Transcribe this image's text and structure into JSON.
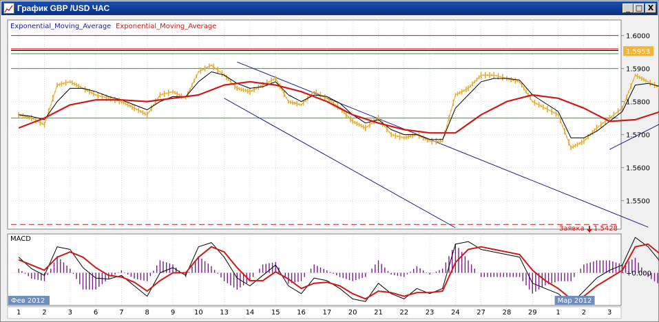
{
  "window": {
    "title": "График GBP /USD ЧАС",
    "buttons": {
      "minimize": "_",
      "maximize": "□",
      "close": "X"
    }
  },
  "chart_data": [
    {
      "type": "line",
      "panel": "price",
      "legend": [
        "Exponential_Moving_Average",
        "Exponential_Moving_Average"
      ],
      "y_ticks": [
        "1.6000",
        "1.5900",
        "1.5800",
        "1.5700",
        "1.5600",
        "1.5500"
      ],
      "ylim": [
        1.5418,
        1.6043
      ],
      "current_price": "1.5953",
      "order_label": "Заявка",
      "order_price": "1.5428",
      "x_tick_labels": [
        "1",
        "2",
        "3",
        "6",
        "7",
        "8",
        "9",
        "10",
        "13",
        "14",
        "15",
        "16",
        "17",
        "20",
        "21",
        "22",
        "23",
        "24",
        "27",
        "28",
        "29",
        "1",
        "2",
        "3"
      ],
      "period_labels": [
        "Фев 2012",
        "Мар 2012"
      ],
      "colors": {
        "price": "#e6a92b",
        "ema_fast": "#000000",
        "ema_slow": "#d01818",
        "horizontal_red": "#c81818",
        "horizontal_green": "#22aa22",
        "channel": "#1c1c8c"
      },
      "horizontal_lines": [
        {
          "price": 1.6,
          "color": "red"
        },
        {
          "price": 1.596,
          "color": "red"
        },
        {
          "price": 1.5955,
          "color": "dark"
        },
        {
          "price": 1.5945,
          "color": "green"
        },
        {
          "price": 1.59,
          "color": "green"
        },
        {
          "price": 1.575,
          "color": "green"
        },
        {
          "price": 1.5428,
          "color": "red-dashed"
        }
      ],
      "trendlines": [
        {
          "from": {
            "x": 8.5,
            "y": 1.592
          },
          "to": {
            "x": 24.5,
            "y": 1.542
          }
        },
        {
          "from": {
            "x": 8.0,
            "y": 1.581
          },
          "to": {
            "x": 17.0,
            "y": 1.5418
          }
        },
        {
          "from": {
            "x": 23.0,
            "y": 1.5655
          },
          "to": {
            "x": 32.5,
            "y": 1.603
          }
        }
      ],
      "series": [
        {
          "name": "close",
          "x": [
            0,
            0.5,
            1,
            1.5,
            2,
            2.5,
            3,
            3.5,
            4,
            4.5,
            5,
            5.5,
            6,
            6.5,
            7,
            7.5,
            8,
            8.5,
            9,
            9.5,
            10,
            10.5,
            11,
            11.5,
            12,
            12.5,
            13,
            13.5,
            14,
            14.5,
            15,
            15.5,
            16,
            16.5,
            17,
            17.5,
            18,
            18.5,
            19,
            19.5,
            20,
            20.5,
            21,
            21.5,
            22,
            22.5,
            23,
            23.5,
            24,
            24.5,
            25,
            25.5,
            26,
            26.5,
            27,
            27.5,
            28,
            28.5,
            29,
            29.5,
            30,
            30.5,
            31
          ],
          "values": [
            1.576,
            1.575,
            1.573,
            1.585,
            1.586,
            1.584,
            1.582,
            1.581,
            1.58,
            1.578,
            1.576,
            1.582,
            1.583,
            1.581,
            1.589,
            1.591,
            1.588,
            1.584,
            1.583,
            1.585,
            1.587,
            1.58,
            1.579,
            1.583,
            1.581,
            1.578,
            1.574,
            1.572,
            1.575,
            1.57,
            1.569,
            1.57,
            1.568,
            1.568,
            1.582,
            1.584,
            1.588,
            1.588,
            1.587,
            1.586,
            1.58,
            1.578,
            1.576,
            1.566,
            1.568,
            1.572,
            1.575,
            1.578,
            1.588,
            1.586,
            1.584,
            1.583,
            1.585,
            1.586,
            1.589,
            1.593,
            1.592,
            1.591,
            1.593,
            1.594,
            1.595,
            1.5953,
            1.5953
          ]
        },
        {
          "name": "ema_fast",
          "x": [
            0,
            0.5,
            1,
            1.5,
            2,
            2.5,
            3,
            3.5,
            4,
            4.5,
            5,
            5.5,
            6,
            6.5,
            7,
            7.5,
            8,
            8.5,
            9,
            9.5,
            10,
            10.5,
            11,
            11.5,
            12,
            12.5,
            13,
            13.5,
            14,
            14.5,
            15,
            15.5,
            16,
            16.5,
            17,
            17.5,
            18,
            18.5,
            19,
            19.5,
            20,
            20.5,
            21,
            21.5,
            22,
            22.5,
            23,
            23.5,
            24,
            24.5,
            25,
            25.5,
            26,
            26.5,
            27,
            27.5,
            28,
            28.5,
            29,
            29.5,
            30,
            30.5
          ],
          "values": [
            1.576,
            1.5755,
            1.5745,
            1.58,
            1.584,
            1.584,
            1.583,
            1.5815,
            1.5805,
            1.579,
            1.5775,
            1.58,
            1.5815,
            1.5815,
            1.586,
            1.589,
            1.588,
            1.5855,
            1.584,
            1.5845,
            1.586,
            1.582,
            1.58,
            1.582,
            1.5815,
            1.5795,
            1.576,
            1.5735,
            1.5745,
            1.5715,
            1.57,
            1.57,
            1.5685,
            1.5685,
            1.578,
            1.582,
            1.586,
            1.587,
            1.587,
            1.5865,
            1.582,
            1.5795,
            1.577,
            1.569,
            1.569,
            1.571,
            1.574,
            1.577,
            1.585,
            1.5855,
            1.5845,
            1.5835,
            1.5845,
            1.5855,
            1.588,
            1.5915,
            1.5918,
            1.5913,
            1.5925,
            1.5935,
            1.5945,
            1.595
          ]
        },
        {
          "name": "ema_slow",
          "x": [
            0,
            1,
            2,
            3,
            4,
            5,
            6,
            7,
            8,
            9,
            10,
            11,
            12,
            13,
            14,
            15,
            16,
            17,
            18,
            19,
            20,
            21,
            22,
            23,
            24,
            25,
            26,
            27,
            28,
            29,
            30,
            30.5
          ],
          "values": [
            1.572,
            1.575,
            1.579,
            1.5805,
            1.5805,
            1.58,
            1.581,
            1.582,
            1.585,
            1.586,
            1.585,
            1.583,
            1.58,
            1.576,
            1.5735,
            1.5715,
            1.5705,
            1.5705,
            1.576,
            1.58,
            1.582,
            1.581,
            1.578,
            1.574,
            1.5745,
            1.577,
            1.581,
            1.583,
            1.586,
            1.589,
            1.5912,
            1.5922
          ]
        }
      ]
    },
    {
      "type": "line",
      "panel": "macd",
      "title": "MACD",
      "y_ticks": [
        "+0.000"
      ],
      "ylim": [
        -0.006,
        0.0072
      ],
      "series": [
        {
          "name": "macd",
          "x": [
            0,
            0.5,
            1,
            1.5,
            2,
            2.5,
            3,
            3.5,
            4,
            4.5,
            5,
            5.5,
            6,
            6.5,
            7,
            7.5,
            8,
            8.5,
            9,
            9.5,
            10,
            10.5,
            11,
            11.5,
            12,
            12.5,
            13,
            13.5,
            14,
            14.5,
            15,
            15.5,
            16,
            16.5,
            17,
            17.5,
            18,
            18.5,
            19,
            19.5,
            20,
            20.5,
            21,
            21.5,
            22,
            22.5,
            23,
            23.5,
            24,
            24.5,
            25,
            25.5,
            26,
            26.5,
            27,
            27.5,
            28,
            28.5,
            29,
            29.5,
            30,
            30.5
          ],
          "values": [
            0.003,
            0.0008,
            -0.0005,
            0.005,
            0.0045,
            0.001,
            -0.001,
            -0.0012,
            -0.0005,
            -0.0025,
            -0.0045,
            0.0,
            0.001,
            -0.0005,
            0.005,
            0.0058,
            0.003,
            -0.001,
            -0.0025,
            -0.0005,
            0.0015,
            -0.0025,
            -0.004,
            -0.001,
            -0.0015,
            -0.003,
            -0.005,
            -0.0055,
            -0.002,
            -0.004,
            -0.005,
            -0.003,
            -0.004,
            -0.003,
            0.0055,
            0.006,
            0.0045,
            0.004,
            0.0035,
            0.003,
            -0.002,
            -0.003,
            -0.004,
            -0.006,
            -0.0035,
            -0.001,
            0.0005,
            0.0015,
            0.0068,
            0.005,
            0.002,
            -0.0005,
            0.0005,
            0.0015,
            0.0035,
            0.004,
            0.0012,
            0.0005,
            0.0018,
            0.0015,
            0.0012,
            0.0015
          ]
        },
        {
          "name": "signal",
          "x": [
            0,
            0.5,
            1,
            1.5,
            2,
            2.5,
            3,
            3.5,
            4,
            4.5,
            5,
            5.5,
            6,
            6.5,
            7,
            7.5,
            8,
            8.5,
            9,
            9.5,
            10,
            10.5,
            11,
            11.5,
            12,
            12.5,
            13,
            13.5,
            14,
            14.5,
            15,
            15.5,
            16,
            16.5,
            17,
            17.5,
            18,
            18.5,
            19,
            19.5,
            20,
            20.5,
            21,
            21.5,
            22,
            22.5,
            23,
            23.5,
            24,
            24.5,
            25,
            25.5,
            26,
            26.5,
            27,
            27.5,
            28,
            28.5,
            29,
            29.5,
            30,
            30.5
          ],
          "values": [
            0.0025,
            0.0015,
            0.0005,
            0.003,
            0.004,
            0.003,
            0.001,
            -0.0005,
            -0.0008,
            -0.0018,
            -0.0035,
            -0.0015,
            0.0,
            0.0,
            0.003,
            0.005,
            0.004,
            0.001,
            -0.0015,
            -0.0015,
            0.0002,
            -0.0012,
            -0.003,
            -0.002,
            -0.0018,
            -0.0025,
            -0.004,
            -0.005,
            -0.0035,
            -0.0038,
            -0.0045,
            -0.0038,
            -0.0038,
            -0.0035,
            0.002,
            0.0045,
            0.005,
            0.0045,
            0.004,
            0.0035,
            0.0005,
            -0.0015,
            -0.003,
            -0.005,
            -0.0045,
            -0.0025,
            -0.001,
            0.0005,
            0.005,
            0.0055,
            0.0035,
            0.001,
            0.0005,
            0.001,
            0.0025,
            0.0035,
            0.002,
            0.001,
            0.0015,
            0.0015,
            0.0013,
            0.0014
          ]
        }
      ]
    }
  ]
}
